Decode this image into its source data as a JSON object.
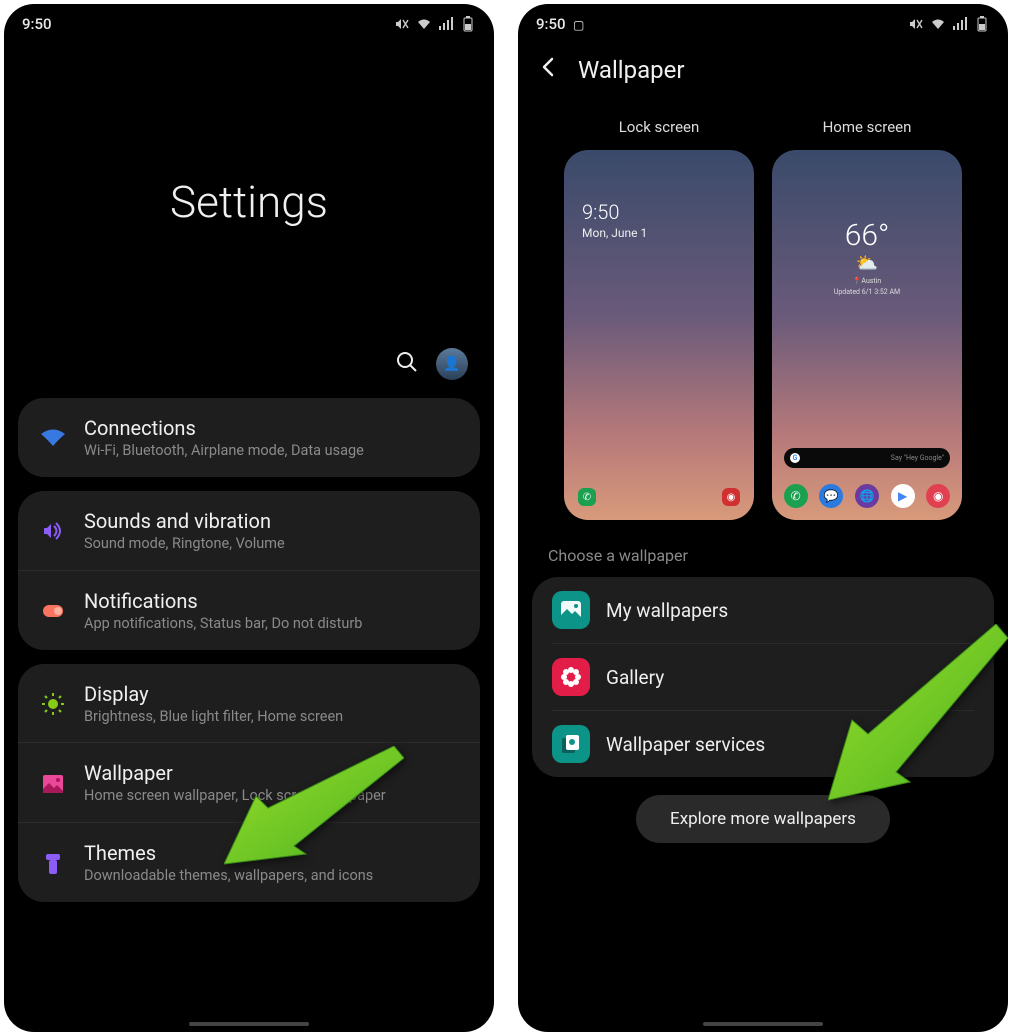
{
  "left": {
    "statusbar": {
      "time": "9:50"
    },
    "hero_title": "Settings",
    "icons": {
      "search": "search-icon",
      "avatar": "avatar"
    },
    "groups": [
      {
        "items": [
          {
            "icon_color": "#3b82f6",
            "icon_name": "wifi-icon",
            "title": "Connections",
            "sub": "Wi-Fi, Bluetooth, Airplane mode, Data usage"
          }
        ]
      },
      {
        "items": [
          {
            "icon_color": "#8b5cf6",
            "icon_name": "sound-icon",
            "title": "Sounds and vibration",
            "sub": "Sound mode, Ringtone, Volume"
          },
          {
            "icon_color": "#f97360",
            "icon_name": "notifications-icon",
            "title": "Notifications",
            "sub": "App notifications, Status bar, Do not disturb"
          }
        ]
      },
      {
        "items": [
          {
            "icon_color": "#84cc16",
            "icon_name": "display-icon",
            "title": "Display",
            "sub": "Brightness, Blue light filter, Home screen"
          },
          {
            "icon_color": "#ec4899",
            "icon_name": "wallpaper-icon",
            "title": "Wallpaper",
            "sub": "Home screen wallpaper, Lock screen wallpaper"
          },
          {
            "icon_color": "#8b5cf6",
            "icon_name": "themes-icon",
            "title": "Themes",
            "sub": "Downloadable themes, wallpapers, and icons"
          }
        ]
      }
    ]
  },
  "right": {
    "statusbar": {
      "time": "9:50"
    },
    "header": {
      "title": "Wallpaper"
    },
    "previews": {
      "lock": {
        "label": "Lock screen",
        "time": "9:50",
        "date": "Mon, June 1"
      },
      "home": {
        "label": "Home screen",
        "temp": "66°",
        "location": "Austin",
        "updated": "Updated 6/1 3:52 AM",
        "search_hint": "Say \"Hey Google\""
      }
    },
    "choose_label": "Choose a wallpaper",
    "wallpaper_options": [
      {
        "icon_bg": "#0d9488",
        "icon_name": "picture-icon",
        "title": "My wallpapers"
      },
      {
        "icon_bg": "#e11d48",
        "icon_name": "flower-icon",
        "title": "Gallery"
      },
      {
        "icon_bg": "#0d9488",
        "icon_name": "services-icon",
        "title": "Wallpaper services"
      }
    ],
    "explore_button": "Explore more wallpapers"
  }
}
